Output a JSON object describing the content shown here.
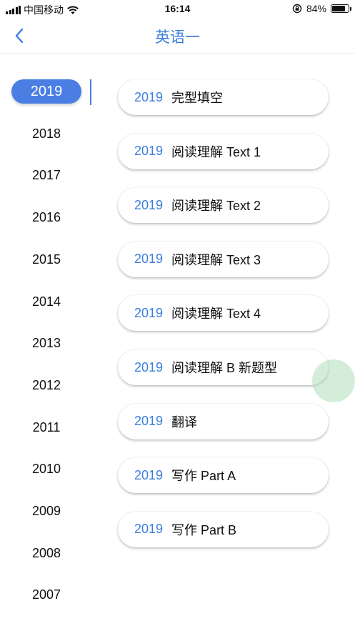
{
  "status_bar": {
    "carrier": "中国移动",
    "time": "16:14",
    "battery_percent": "84%",
    "battery_level": 0.84
  },
  "nav": {
    "title": "英语一",
    "back_icon": "chevron-left-icon"
  },
  "years": [
    "2019",
    "2018",
    "2017",
    "2016",
    "2015",
    "2014",
    "2013",
    "2012",
    "2011",
    "2010",
    "2009",
    "2008",
    "2007"
  ],
  "selected_year": "2019",
  "exams": [
    {
      "year": "2019",
      "name": "完型填空"
    },
    {
      "year": "2019",
      "name": "阅读理解 Text 1"
    },
    {
      "year": "2019",
      "name": "阅读理解 Text 2"
    },
    {
      "year": "2019",
      "name": "阅读理解 Text 3"
    },
    {
      "year": "2019",
      "name": "阅读理解 Text 4"
    },
    {
      "year": "2019",
      "name": "阅读理解 B 新题型"
    },
    {
      "year": "2019",
      "name": "翻译"
    },
    {
      "year": "2019",
      "name": "写作 Part A"
    },
    {
      "year": "2019",
      "name": "写作 Part B"
    }
  ],
  "colors": {
    "accent": "#4a7ee3",
    "title": "#3b7ddd"
  }
}
